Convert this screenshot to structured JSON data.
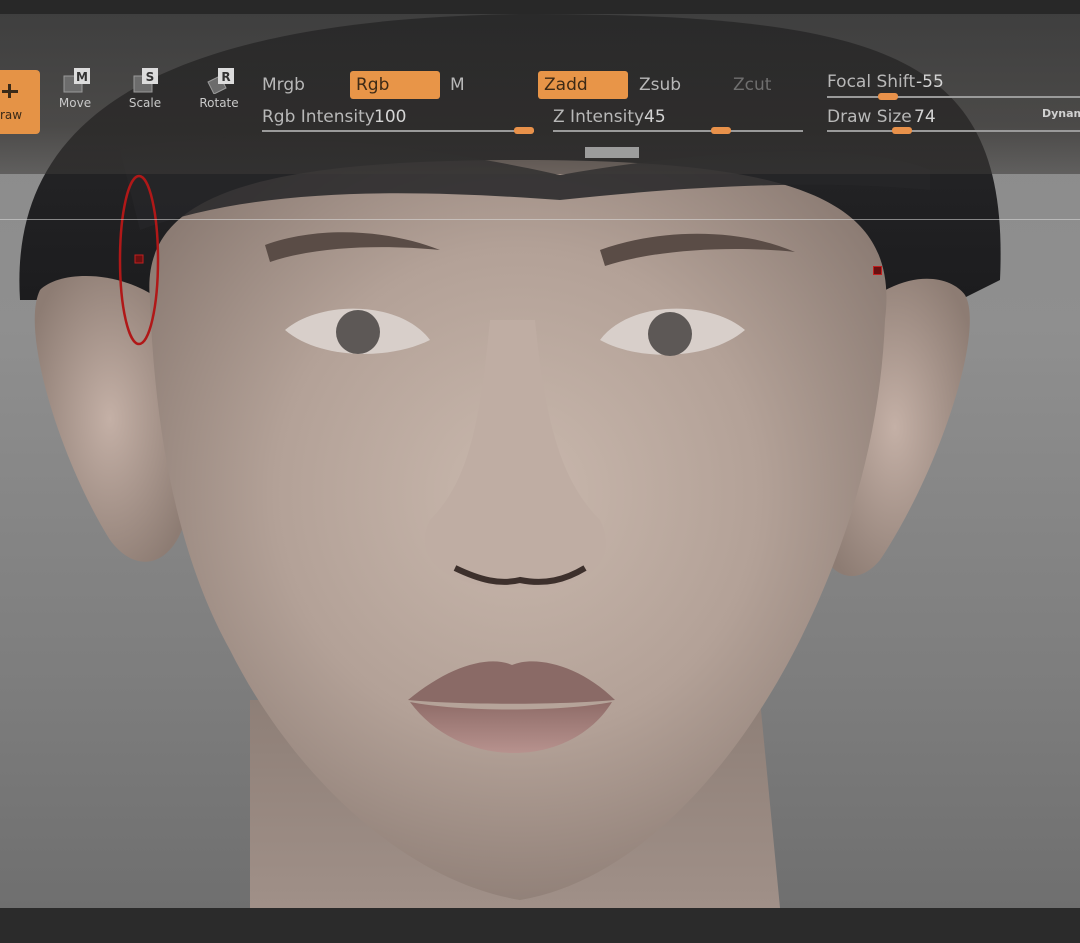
{
  "toolbar": {
    "buttons": {
      "draw": "raw",
      "move": "Move",
      "scale": "Scale",
      "rotate": "Rotate"
    },
    "icon_letters": {
      "move": "M",
      "scale": "S",
      "rotate": "R"
    },
    "color_modes": {
      "mrgb": "Mrgb",
      "rgb": "Rgb",
      "m": "M"
    },
    "z_modes": {
      "zadd": "Zadd",
      "zsub": "Zsub",
      "zcut": "Zcut"
    },
    "rgb_intensity": {
      "label": "Rgb Intensity",
      "value": "100"
    },
    "z_intensity": {
      "label": "Z Intensity",
      "value": "45"
    },
    "focal_shift": {
      "label": "Focal Shift",
      "value": "-55"
    },
    "draw_size": {
      "label": "Draw Size",
      "value": "74"
    },
    "dynamic_label": "Dynam",
    "active": {
      "tool": "draw",
      "color_mode": "Rgb",
      "z_mode": "Zadd"
    }
  },
  "colors": {
    "accent": "#e89548",
    "toolbar_bg": "#2f2e2c",
    "brush_ring": "#b01818"
  },
  "icons": {
    "draw": "draw-brush-icon",
    "move": "move-brush-icon",
    "scale": "scale-brush-icon",
    "rotate": "rotate-brush-icon"
  }
}
